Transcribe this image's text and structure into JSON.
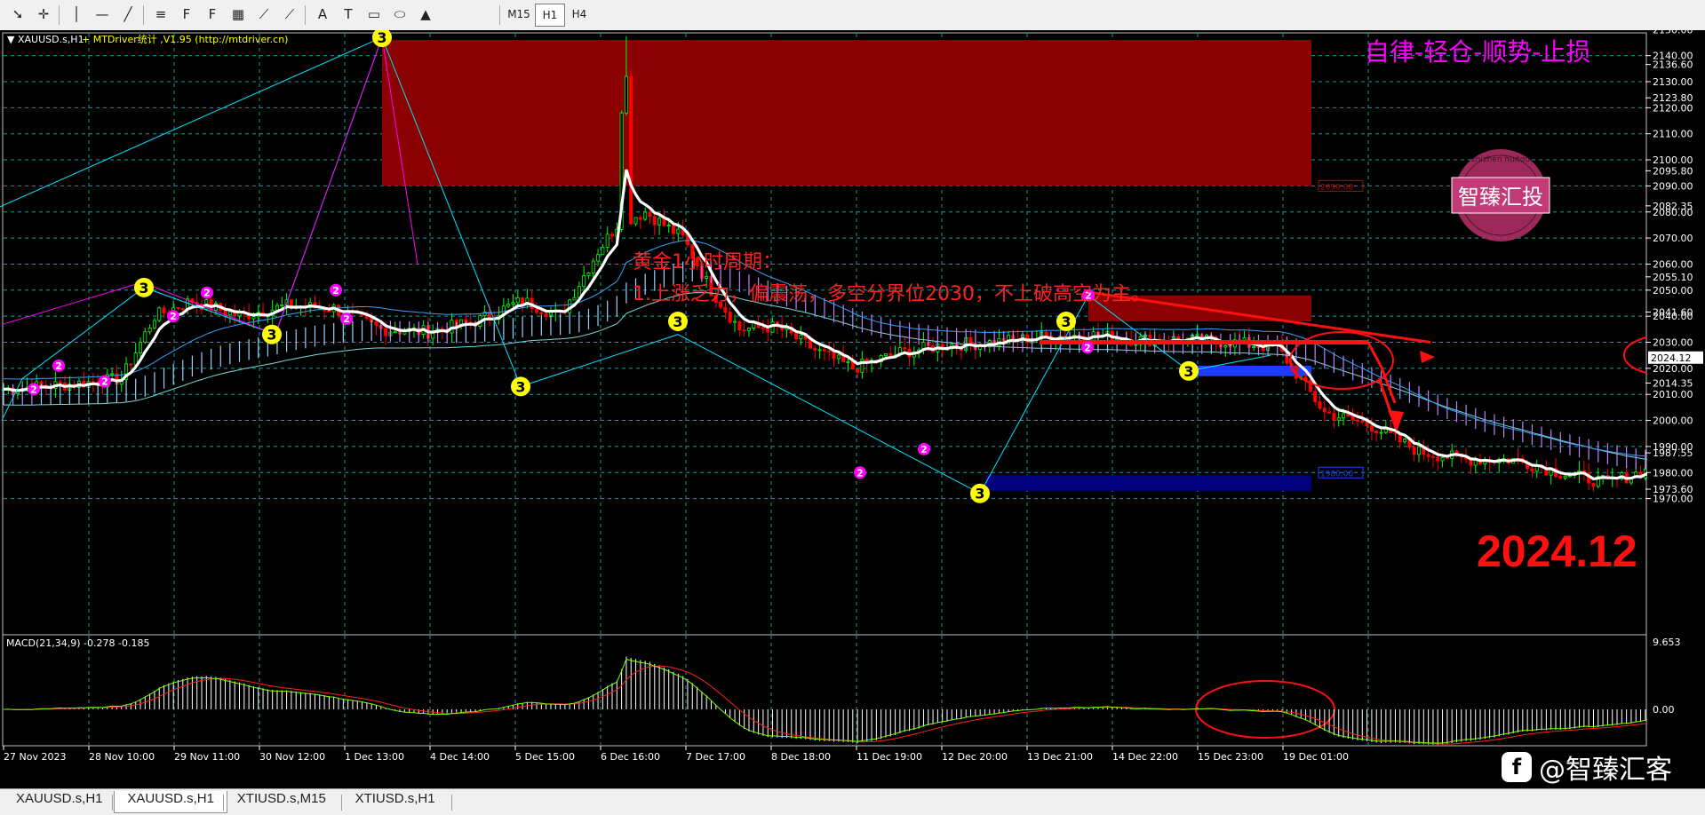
{
  "toolbar": {
    "tools": [
      {
        "name": "cursor-icon",
        "glyph": "➘"
      },
      {
        "name": "crosshair-icon",
        "glyph": "✛"
      },
      {
        "name": "vertical-line-icon",
        "glyph": "│"
      },
      {
        "name": "horizontal-line-icon",
        "glyph": "—"
      },
      {
        "name": "trendline-icon",
        "glyph": "╱"
      },
      {
        "name": "equidistant-channel-icon",
        "glyph": "≡"
      },
      {
        "name": "fibonacci-retracement-icon",
        "glyph": "F"
      },
      {
        "name": "fibonacci-fan-icon",
        "glyph": "F"
      },
      {
        "name": "gann-grid-icon",
        "glyph": "▦"
      },
      {
        "name": "gann-fan-icon",
        "glyph": "⟋"
      },
      {
        "name": "gann-line-icon",
        "glyph": "⟋"
      },
      {
        "name": "text-icon",
        "glyph": "A"
      },
      {
        "name": "text-label-icon",
        "glyph": "T"
      },
      {
        "name": "rectangle-icon",
        "glyph": "▭"
      },
      {
        "name": "ellipse-icon",
        "glyph": "⬭"
      },
      {
        "name": "triangle-icon",
        "glyph": "▲"
      }
    ],
    "timeframes": [
      "M15",
      "H1",
      "H4"
    ]
  },
  "chart": {
    "title_symbol": "XAUUSD.s,H1",
    "indicator_label": "MTDriver统计 ,V1.95 (http://mtdriver.cn)",
    "motto": "自律-轻仓-顺势-止损",
    "stamp_text": "智臻汇投",
    "stamp_ring_text": "zhizhen huitou",
    "annotation_line1": "黄金1小时周期：",
    "annotation_line2": "1.上涨乏力，偏震荡，多空分界位2030，不上破高空为主。",
    "date_stamp": "2024.12",
    "current_price": "2024.12",
    "zone_price_upper": "2090.00",
    "zone_price_lower": "1980.00",
    "macd_label": "MACD(21,34,9) -0.278 -0.185",
    "macd_axis": [
      "9.653",
      "0.00"
    ],
    "price_axis": [
      "2150.00",
      "2140.00",
      "2136.60",
      "2130.00",
      "2123.80",
      "2120.00",
      "2110.00",
      "2100.00",
      "2095.80",
      "2090.00",
      "2082.35",
      "2080.00",
      "2070.00",
      "2060.00",
      "2055.10",
      "2050.00",
      "2041.60",
      "2040.00",
      "2030.00",
      "2020.00",
      "2014.35",
      "2010.00",
      "2000.00",
      "1990.00",
      "1987.55",
      "1980.00",
      "1973.60",
      "1970.00"
    ],
    "time_axis": [
      "27 Nov 2023",
      "28 Nov 10:00",
      "29 Nov 11:00",
      "30 Nov 12:00",
      "1 Dec 13:00",
      "4 Dec 14:00",
      "5 Dec 15:00",
      "6 Dec 16:00",
      "7 Dec 17:00",
      "8 Dec 18:00",
      "11 Dec 19:00",
      "12 Dec 20:00",
      "13 Dec 21:00",
      "14 Dec 22:00",
      "15 Dec 23:00",
      "19 Dec 01:00"
    ],
    "wave_labels": [
      "2",
      "2",
      "2",
      "3",
      "2",
      "2",
      "3",
      "2",
      "2",
      "3",
      "3",
      "3",
      "2",
      "2",
      "3",
      "2",
      "3",
      "2",
      "3"
    ],
    "colors": {
      "bull": "#00ff00",
      "bear": "#ff0000",
      "grid": "#00b5b5",
      "axis_text": "#ffffff",
      "supply_zone": "#8b0000",
      "demand_zone": "#000080",
      "annotation": "#ff2020",
      "motto": "#ff00ff"
    }
  },
  "tabs": [
    "XAUUSD.s,H1",
    "XAUUSD.s,H1",
    "XTIUSD.s,M15",
    "XTIUSD.s,H1"
  ],
  "active_tab": 1,
  "watermark": {
    "text": "@智臻汇客",
    "logo_glyph": "f"
  }
}
